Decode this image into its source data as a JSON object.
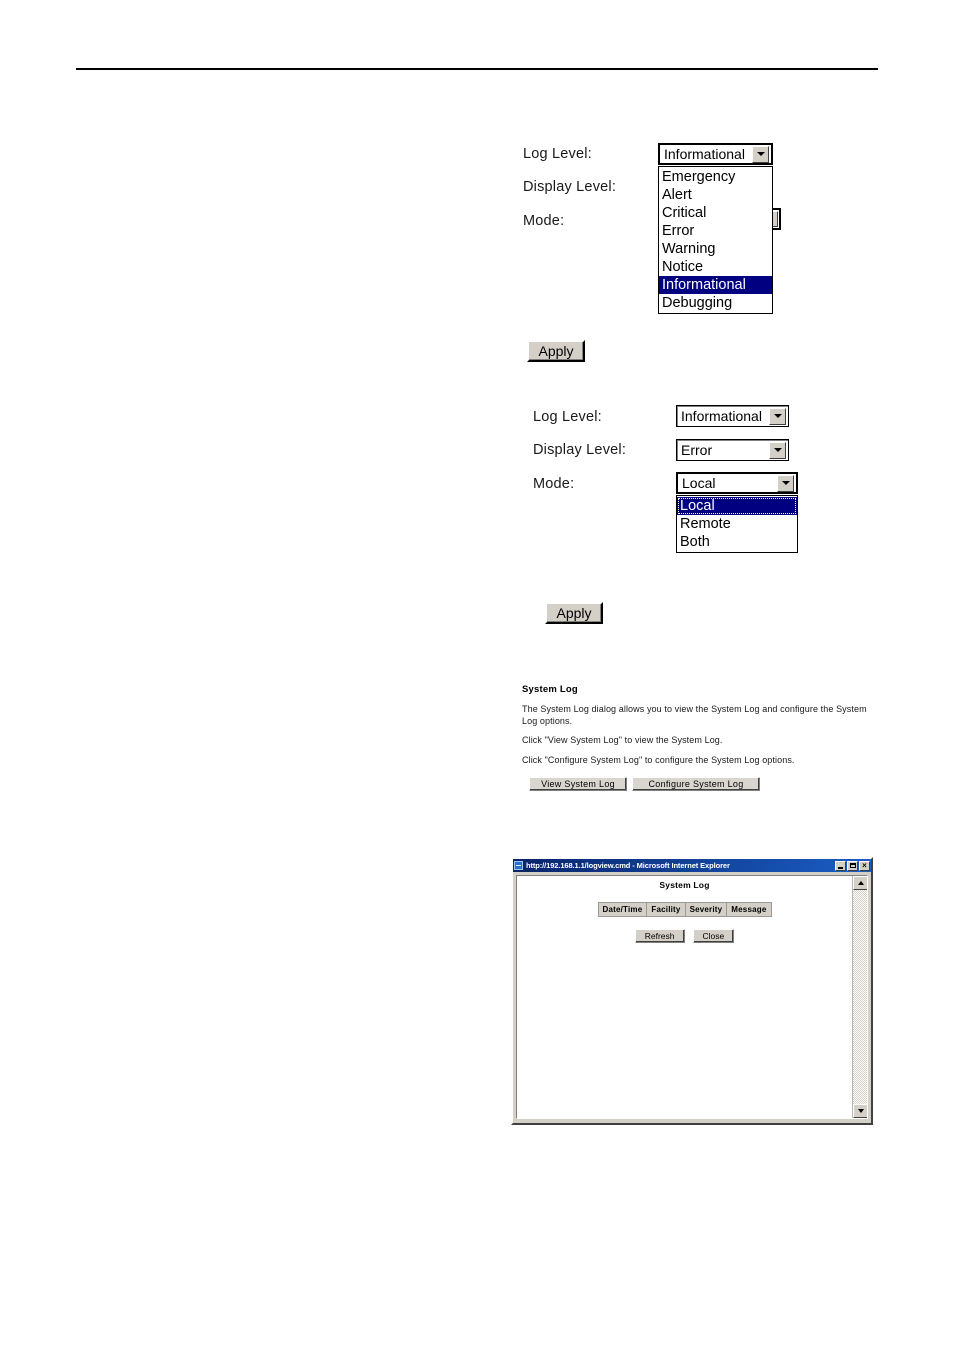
{
  "page": {
    "background": "#ffffff",
    "rule_color": "#000000"
  },
  "colors": {
    "selection_bg": "#000080",
    "selection_fg": "#ffffff",
    "button_face": "#d4d0c8",
    "titlebar_blue": "#08246b"
  },
  "section_log_level": {
    "labels": {
      "log_level": "Log Level:",
      "display_level": "Display Level:",
      "mode": "Mode:"
    },
    "log_level_select": {
      "value": "Informational",
      "expanded": true,
      "options": [
        "Emergency",
        "Alert",
        "Critical",
        "Error",
        "Warning",
        "Notice",
        "Informational",
        "Debugging"
      ],
      "selected_index": 6
    },
    "apply_label": "Apply"
  },
  "section_mode": {
    "labels": {
      "log_level": "Log Level:",
      "display_level": "Display Level:",
      "mode": "Mode:"
    },
    "log_level_select": {
      "value": "Informational"
    },
    "display_level_select": {
      "value": "Error"
    },
    "mode_select": {
      "value": "Local",
      "expanded": true,
      "options": [
        "Local",
        "Remote",
        "Both"
      ],
      "selected_index": 0
    },
    "apply_label": "Apply"
  },
  "help_panel": {
    "title": "System Log",
    "paragraphs": [
      "The System Log dialog allows you to view the System Log and configure the System Log options.",
      "Click \"View System Log\" to view the System Log.",
      "Click \"Configure System Log\" to configure the System Log options."
    ],
    "buttons": {
      "view": "View System Log",
      "configure": "Configure System Log"
    }
  },
  "ie_window": {
    "title": "http://192.168.1.1/logview.cmd - Microsoft Internet Explorer",
    "window_buttons": {
      "minimize": "_",
      "maximize": "□",
      "close": "×"
    },
    "document_title": "System Log",
    "table": {
      "headers": [
        "Date/Time",
        "Facility",
        "Severity",
        "Message"
      ],
      "rows": []
    },
    "buttons": {
      "refresh": "Refresh",
      "close": "Close"
    }
  }
}
